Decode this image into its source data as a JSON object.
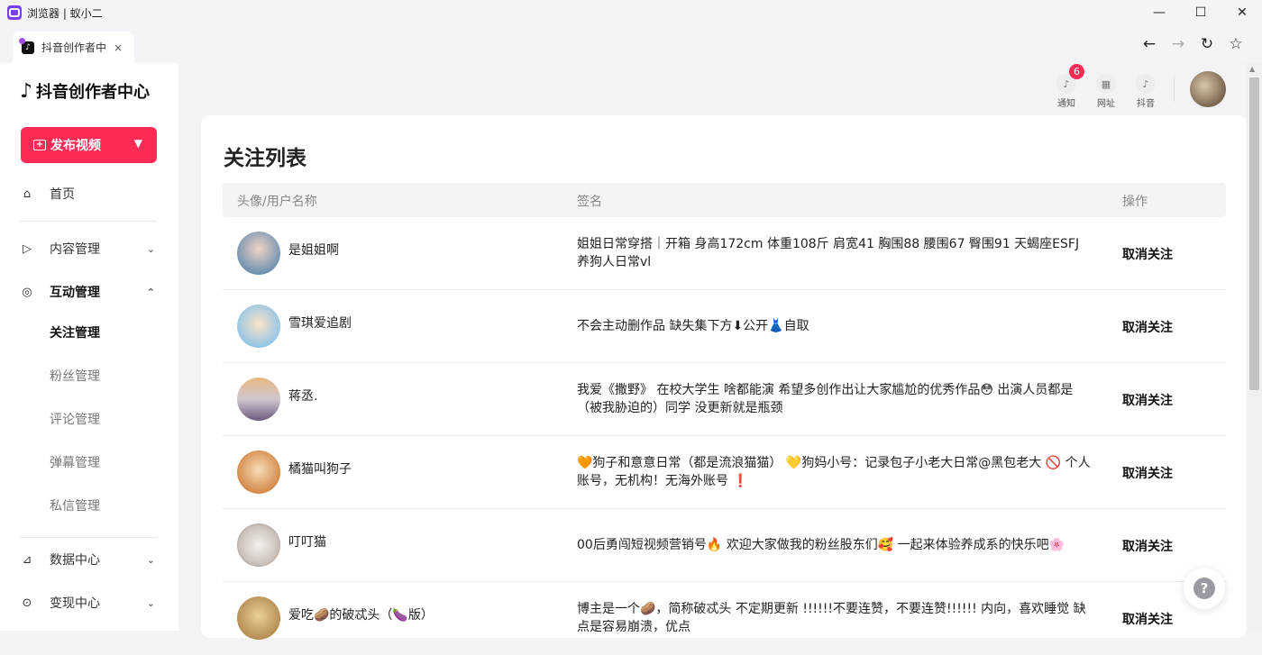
{
  "window": {
    "title": "浏览器 | 蚁小二",
    "minimize": "—",
    "maximize": "☐",
    "close": "✕"
  },
  "tab": {
    "title": "抖音创作者中",
    "close": "×"
  },
  "nav": {
    "back": "←",
    "forward": "→",
    "reload": "↻",
    "bookmark": "☆"
  },
  "sidebar": {
    "logo_text": "抖音创作者中心",
    "publish_label": "发布视频",
    "items": [
      {
        "label": "首页"
      },
      {
        "label": "内容管理"
      },
      {
        "label": "互动管理"
      },
      {
        "label": "数据中心"
      },
      {
        "label": "变现中心"
      }
    ],
    "sub_items": [
      {
        "label": "关注管理"
      },
      {
        "label": "粉丝管理"
      },
      {
        "label": "评论管理"
      },
      {
        "label": "弹幕管理"
      },
      {
        "label": "私信管理"
      }
    ]
  },
  "header": {
    "notify_label": "通知",
    "notify_count": "6",
    "site_label": "网址",
    "douyin_label": "抖音"
  },
  "main": {
    "title": "关注列表",
    "columns": [
      "头像/用户名称",
      "签名",
      "操作"
    ],
    "rows": [
      {
        "name": "是姐姐啊",
        "sig": "姐姐日常穿搭｜开箱 身高172cm 体重108斤 肩宽41 胸围88 腰围67 臀围91 天蝎座ESFJ 养狗人日常vl",
        "action": "取消关注"
      },
      {
        "name": "雪琪爱追剧",
        "sig": "不会主动删作品 缺失集下方⬇公开👗自取",
        "action": "取消关注"
      },
      {
        "name": "蒋丞.",
        "sig": "我爱《撒野》 在校大学生 啥都能演 希望多创作出让大家尴尬的优秀作品😳 出演人员都是（被我胁迫的）同学 没更新就是瓶颈",
        "action": "取消关注"
      },
      {
        "name": "橘猫叫狗子",
        "sig": "🧡狗子和意意日常（都是流浪猫猫） 💛狗妈小号：记录包子小老大日常@黑包老大 🚫 个人账号，无机构！无海外账号 ❗",
        "action": "取消关注"
      },
      {
        "name": "叮叮猫",
        "sig": "00后勇闯短视频营销号🔥 欢迎大家做我的粉丝股东们🥰 一起来体验养成系的快乐吧🌸",
        "action": "取消关注"
      },
      {
        "name": "爱吃🥔的破忒头（🍆版）",
        "sig": "博主是一个🥔，简称破忒头 不定期更新 !!!!!!不要连赞，不要连赞!!!!!! 内向，喜欢睡觉 缺点是容易崩溃，优点",
        "action": "取消关注"
      }
    ]
  },
  "help_label": "?"
}
